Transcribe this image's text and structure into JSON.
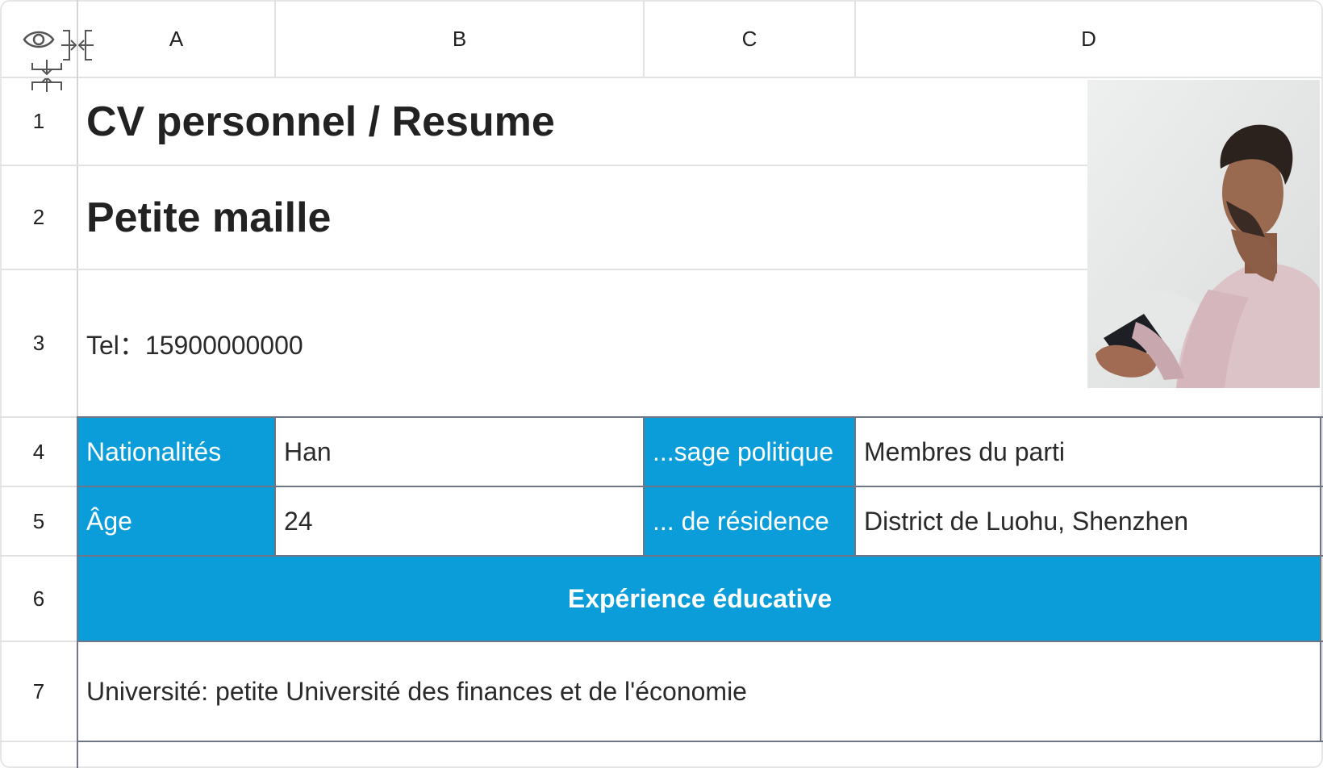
{
  "columns": [
    "A",
    "B",
    "C",
    "D"
  ],
  "rows": [
    "1",
    "2",
    "3",
    "4",
    "5",
    "6",
    "7"
  ],
  "icons": {
    "show_hidden": "eye-icon",
    "collapse_columns": "collapse-columns-icon",
    "collapse_rows": "collapse-rows-icon"
  },
  "cells": {
    "title": "CV personnel / Resume",
    "name": "Petite maille",
    "tel": "Tel：15900000000",
    "nationality_label": "Nationalités",
    "nationality_value": "Han",
    "political_label": "...sage politique",
    "political_value": "Membres du parti",
    "age_label": "Âge",
    "age_value": "24",
    "residence_label": "... de résidence",
    "residence_value": "District de Luohu, Shenzhen",
    "education_header": "Expérience éducative",
    "university": "Université: petite Université des finances et de l'économie"
  },
  "colors": {
    "accent": "#0b9dd9",
    "table_border": "#6e7585",
    "grid": "#e2e2e2"
  }
}
